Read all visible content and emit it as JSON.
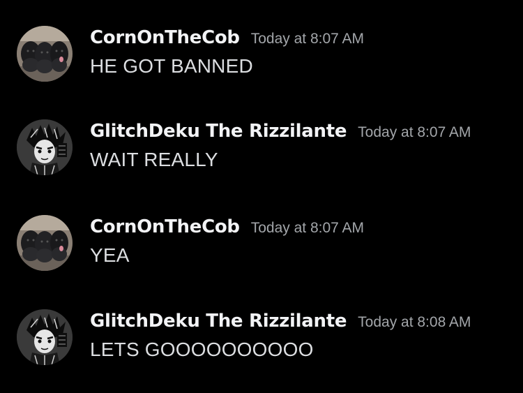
{
  "messages": [
    {
      "username": "CornOnTheCob",
      "timestamp": "Today at 8:07 AM",
      "content": "HE GOT BANNED",
      "avatar_icon": "dog-puppies-avatar"
    },
    {
      "username": "GlitchDeku The Rizzilante",
      "timestamp": "Today at 8:07 AM",
      "content": "WAIT REALLY",
      "avatar_icon": "anime-character-avatar"
    },
    {
      "username": "CornOnTheCob",
      "timestamp": "Today at 8:07 AM",
      "content": "YEA",
      "avatar_icon": "dog-puppies-avatar"
    },
    {
      "username": "GlitchDeku The Rizzilante",
      "timestamp": "Today at 8:08 AM",
      "content": "LETS GOOOOOOOOOO",
      "avatar_icon": "anime-character-avatar"
    }
  ],
  "colors": {
    "background": "#000000",
    "username": "#f2f3f5",
    "timestamp": "#a3a6aa",
    "content": "#dcdee1"
  }
}
